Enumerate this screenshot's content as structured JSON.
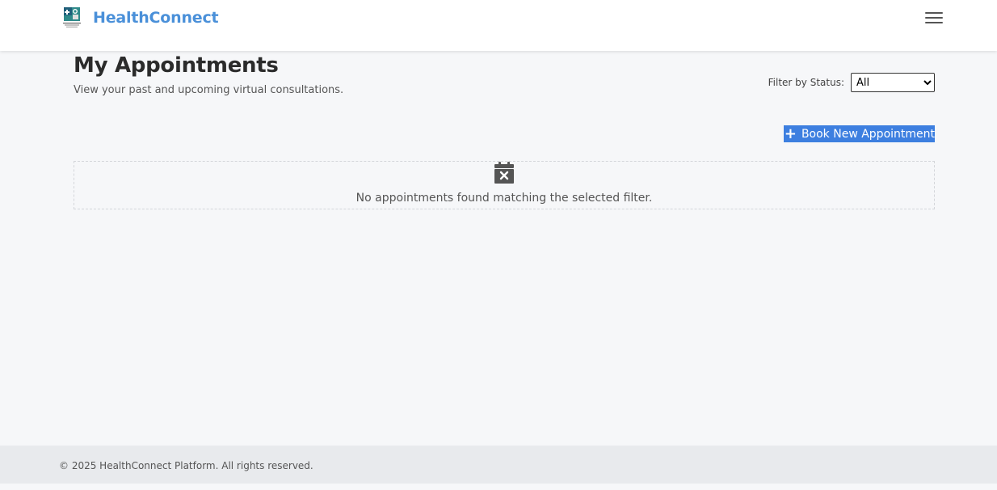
{
  "header": {
    "brand_name": "HealthConnect",
    "logo_icon": "healthconnect-logo",
    "menu_icon": "hamburger-menu-icon",
    "brand_color": "#4a90d9"
  },
  "main": {
    "title": "My Appointments",
    "subtitle": "View your past and upcoming virtual consultations.",
    "filter": {
      "label": "Filter by Status:",
      "selected": "All"
    },
    "book_button": {
      "icon": "+",
      "label": "Book New Appointment"
    },
    "empty_state": {
      "icon": "calendar-x-icon",
      "message": "No appointments found matching the selected filter."
    }
  },
  "footer": {
    "copyright": "© 2025 HealthConnect Platform. All rights reserved."
  }
}
